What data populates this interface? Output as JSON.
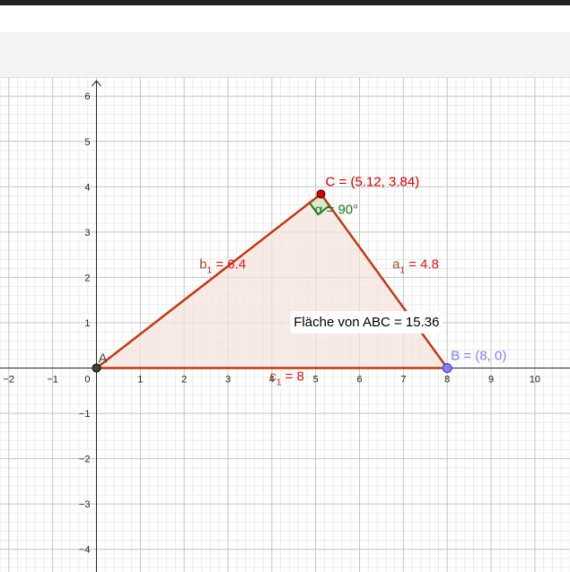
{
  "app": {
    "header_color": "#1f1f26",
    "toolbar_color": "#f3f3f3"
  },
  "axes": {
    "x_ticks": [
      "−2",
      "−1",
      "0",
      "1",
      "2",
      "3",
      "4",
      "5",
      "6",
      "7",
      "8",
      "9",
      "10"
    ],
    "y_ticks": [
      "−4",
      "−3",
      "−2",
      "−1",
      "1",
      "2",
      "3",
      "4",
      "5",
      "6"
    ],
    "x_range": [
      -2.2,
      10.8
    ],
    "y_range": [
      -4.5,
      6.4
    ],
    "grid": true
  },
  "geometry": {
    "points": [
      {
        "id": "A",
        "label": "A",
        "x": 0,
        "y": 0,
        "color": "#444444"
      },
      {
        "id": "B",
        "label": "B = (8, 0)",
        "x": 8,
        "y": 0,
        "color": "#7f7fff"
      },
      {
        "id": "C",
        "label": "C = (5.12, 3.84)",
        "x": 5.12,
        "y": 3.84,
        "color": "#cc0000"
      }
    ],
    "segments": [
      {
        "id": "a",
        "name": "a",
        "sub": "1",
        "value": " = 4.8",
        "color": "#b03a10"
      },
      {
        "id": "b",
        "name": "b",
        "sub": "1",
        "value": " = 6.4",
        "color": "#b03a10"
      },
      {
        "id": "c",
        "name": "c",
        "sub": "1",
        "value": " = 8",
        "color": "#b03a10"
      }
    ],
    "angle": {
      "label": "α = 90°",
      "color": "#1b7a1b"
    },
    "area_text": "Fläche von  ABC = 15.36",
    "fill_color": "#f5e4dc",
    "stroke_color": "#c03a15",
    "label_color": "#e0141c"
  }
}
